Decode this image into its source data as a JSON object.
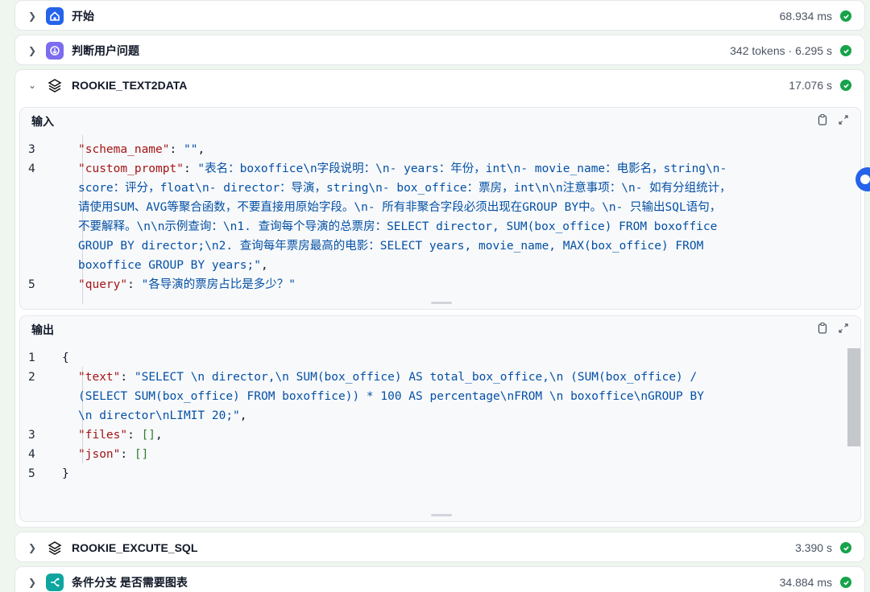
{
  "nodes": {
    "start": {
      "title": "开始",
      "meta": "68.934 ms"
    },
    "judge": {
      "title": "判断用户问题",
      "meta": "342 tokens · 6.295 s"
    },
    "text2data": {
      "title": "ROOKIE_TEXT2DATA",
      "meta": "17.076 s"
    },
    "excute_sql": {
      "title": "ROOKIE_EXCUTE_SQL",
      "meta": "3.390 s"
    },
    "branch": {
      "title": "条件分支 是否需要图表",
      "meta": "34.884 ms"
    }
  },
  "input_panel": {
    "title": "输入",
    "lines": [
      {
        "num": "3",
        "key": "\"schema_name\"",
        "sep": ": ",
        "val": "\"\"",
        "end": ","
      },
      {
        "num": "4",
        "key": "\"custom_prompt\"",
        "sep": ": ",
        "val": "\"表名：boxoffice\\n字段说明：\\n- years：年份，int\\n- movie_name：电影名，string\\n-",
        "end": ""
      },
      {
        "num": "",
        "key": "",
        "sep": "",
        "val": "score：评分，float\\n- director：导演，string\\n- box_office：票房，int\\n\\n注意事项：\\n- 如有分组统计，",
        "end": ""
      },
      {
        "num": "",
        "key": "",
        "sep": "",
        "val": "请使用SUM、AVG等聚合函数，不要直接用原始字段。\\n- 所有非聚合字段必须出现在GROUP BY中。\\n- 只输出SQL语句，",
        "end": ""
      },
      {
        "num": "",
        "key": "",
        "sep": "",
        "val": "不要解释。\\n\\n示例查询：\\n1. 查询每个导演的总票房：SELECT director, SUM(box_office) FROM boxoffice",
        "end": ""
      },
      {
        "num": "",
        "key": "",
        "sep": "",
        "val": "GROUP BY director;\\n2. 查询每年票房最高的电影：SELECT years, movie_name, MAX(box_office) FROM",
        "end": ""
      },
      {
        "num": "",
        "key": "",
        "sep": "",
        "val": "boxoffice GROUP BY years;\"",
        "end": ","
      },
      {
        "num": "5",
        "key": "\"query\"",
        "sep": ": ",
        "val": "\"各导演的票房占比是多少？\"",
        "end": ""
      }
    ]
  },
  "output_panel": {
    "title": "输出",
    "lines": [
      {
        "num": "1",
        "key": "",
        "sep": "",
        "val": "",
        "end": "{"
      },
      {
        "num": "2",
        "key": "\"text\"",
        "sep": ": ",
        "val": "\"SELECT \\n    director,\\n    SUM(box_office) AS total_box_office,\\n    (SUM(box_office) /",
        "end": ""
      },
      {
        "num": "",
        "key": "",
        "sep": "",
        "val": "(SELECT SUM(box_office) FROM boxoffice)) * 100 AS percentage\\nFROM \\n    boxoffice\\nGROUP BY",
        "end": ""
      },
      {
        "num": "",
        "key": "",
        "sep": "",
        "val": "\\n    director\\nLIMIT 20;\"",
        "end": ","
      },
      {
        "num": "3",
        "key": "\"files\"",
        "sep": ": ",
        "val": "",
        "arr": "[]",
        "end": ","
      },
      {
        "num": "4",
        "key": "\"json\"",
        "sep": ": ",
        "val": "",
        "arr": "[]",
        "end": ""
      },
      {
        "num": "5",
        "key": "",
        "sep": "",
        "val": "",
        "end": "}"
      }
    ]
  },
  "colors": {
    "success": "#16a34a",
    "accent": "#2563eb"
  }
}
